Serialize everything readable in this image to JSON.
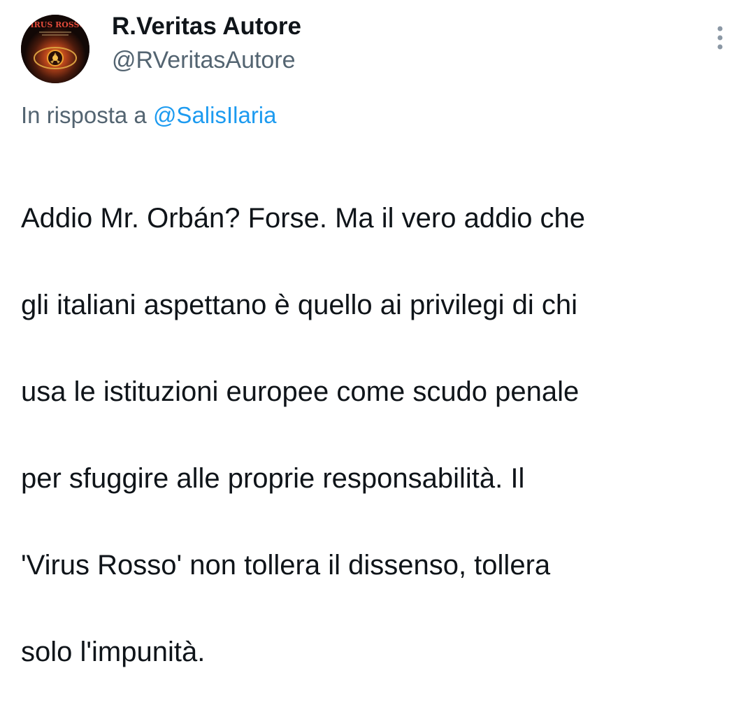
{
  "author": {
    "display_name": "R.Veritas Autore",
    "handle": "@RVeritasAutore",
    "avatar_label": "VIRUS ROSSO",
    "avatar_icon": "book-cover-eye-icon"
  },
  "menu": {
    "icon": "more-vertical-icon"
  },
  "reply": {
    "prefix": "In risposta a",
    "mention": "@SalisIlaria"
  },
  "tweet": {
    "lines": [
      "Addio Mr. Orbán? Forse. Ma il vero addio che",
      "gli italiani aspettano è quello ai privilegi di chi",
      "usa le istituzioni europee come scudo penale",
      "per sfuggire alle proprie responsabilità. Il",
      "'Virus Rosso' non tollera il dissenso, tollera",
      "solo l'impunità."
    ]
  },
  "colors": {
    "text": "#0f1419",
    "secondary": "#536471",
    "link": "#1d9bf0",
    "background": "#ffffff"
  }
}
